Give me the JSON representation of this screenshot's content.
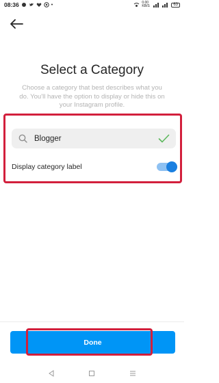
{
  "status_bar": {
    "time": "08:36",
    "network_speed": "0.00 KB/S",
    "battery": "63"
  },
  "header": {
    "back_icon": "arrow-left-icon"
  },
  "main": {
    "title": "Select a Category",
    "subtitle": "Choose a category that best describes what you do. You'll have the option to display or hide this on your Instagram profile.",
    "search": {
      "value": "Blogger",
      "icon": "search-icon",
      "valid_icon": "checkmark-icon"
    },
    "toggle": {
      "label": "Display category label",
      "state": "on"
    }
  },
  "footer": {
    "done_label": "Done"
  },
  "colors": {
    "accent": "#0095f6",
    "toggle_track": "#8ec1f2",
    "toggle_knob": "#1a7fe0",
    "check": "#5cb85c",
    "highlight": "#d21f3c"
  }
}
